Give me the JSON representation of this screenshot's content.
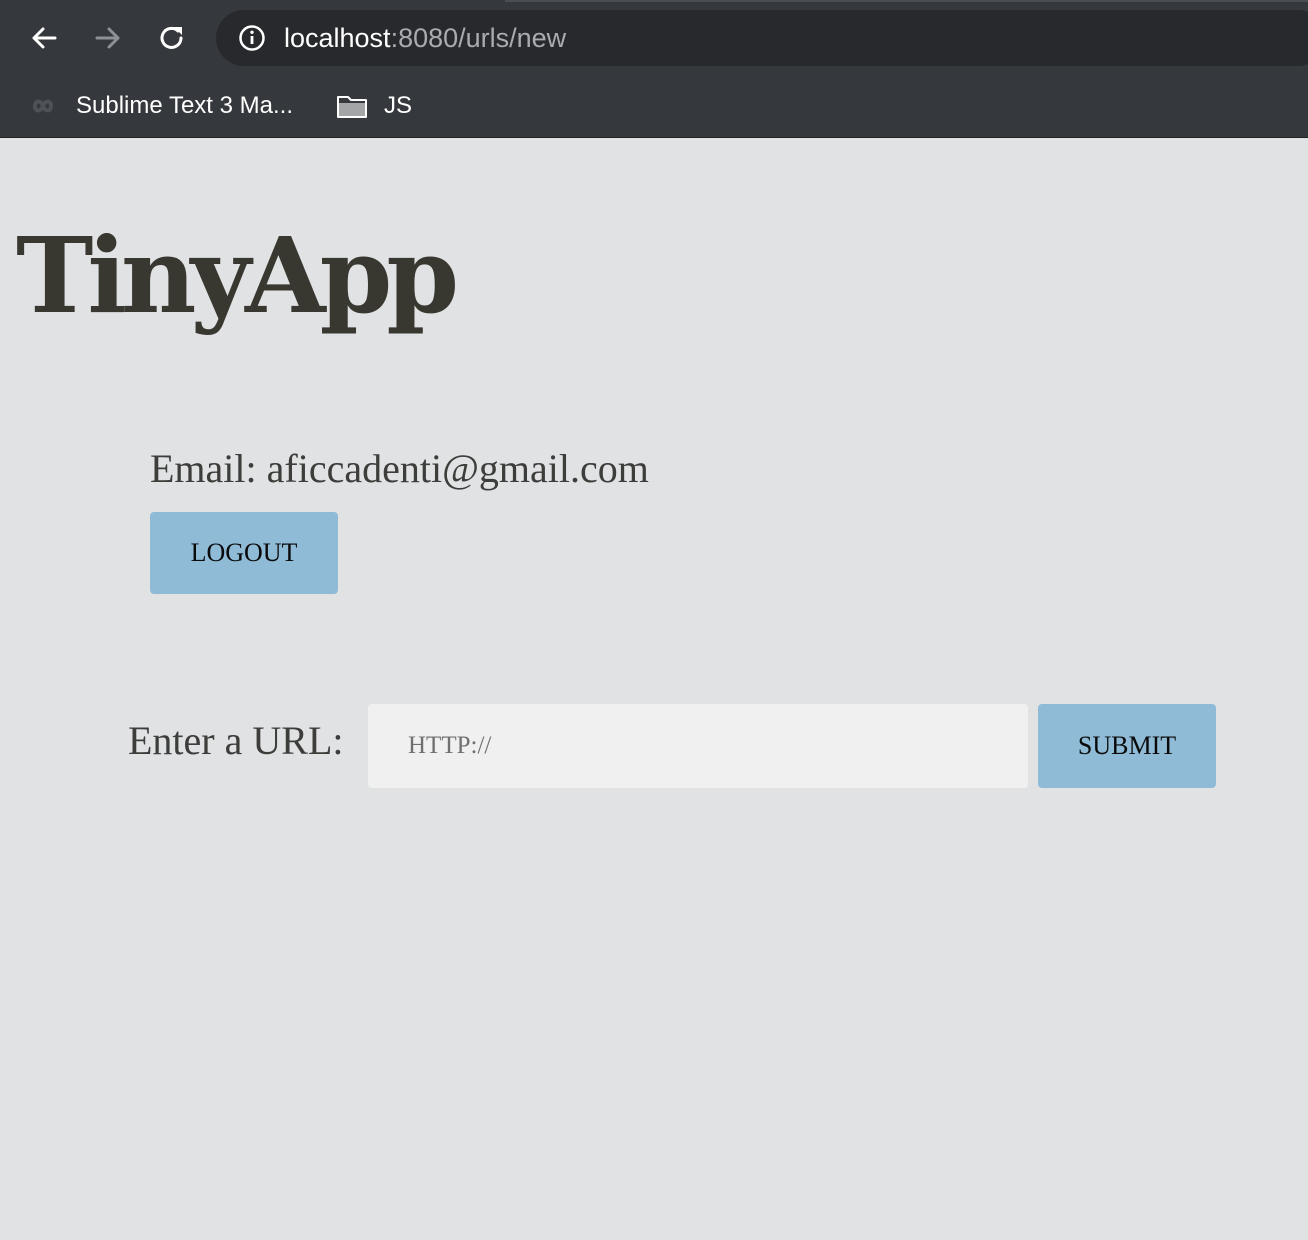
{
  "browser": {
    "url_host": "localhost",
    "url_path": ":8080/urls/new",
    "bookmarks": [
      {
        "label": "Sublime Text 3 Ma...",
        "icon": "sublime-icon"
      },
      {
        "label": "JS",
        "icon": "folder-icon"
      }
    ]
  },
  "page": {
    "title": "TinyApp",
    "email_text": "Email: aficcadenti@gmail.com",
    "logout_label": "LOGOUT",
    "url_label": "Enter a URL:",
    "url_placeholder": "HTTP://",
    "submit_label": "SUBMIT"
  },
  "colors": {
    "background": "#e1e2e4",
    "button": "#8fbbd6",
    "chrome": "#35383c"
  }
}
